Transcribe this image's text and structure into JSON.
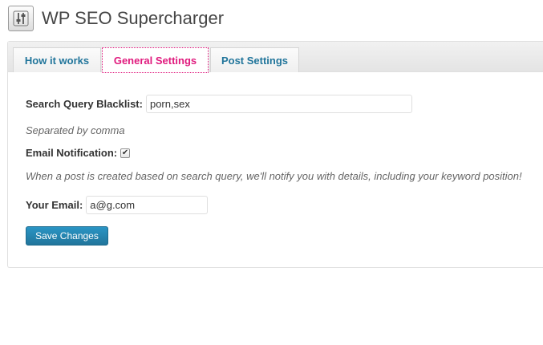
{
  "header": {
    "title": "WP SEO Supercharger",
    "icon": "settings-sliders-icon"
  },
  "tabs": [
    {
      "label": "How it works",
      "active": false
    },
    {
      "label": "General Settings",
      "active": true
    },
    {
      "label": "Post Settings",
      "active": false
    }
  ],
  "form": {
    "blacklist_label": "Search Query Blacklist:",
    "blacklist_value": "porn,sex",
    "blacklist_hint": "Separated by comma",
    "email_notification_label": "Email Notification:",
    "email_notification_checked": true,
    "email_notification_hint": "When a post is created based on search query, we'll notify you with details, including your keyword position!",
    "email_label": "Your Email:",
    "email_value": "a@g.com",
    "save_label": "Save Changes"
  },
  "colors": {
    "link_blue": "#21759b",
    "active_tab": "#e0197d",
    "button_blue": "#21759b"
  }
}
